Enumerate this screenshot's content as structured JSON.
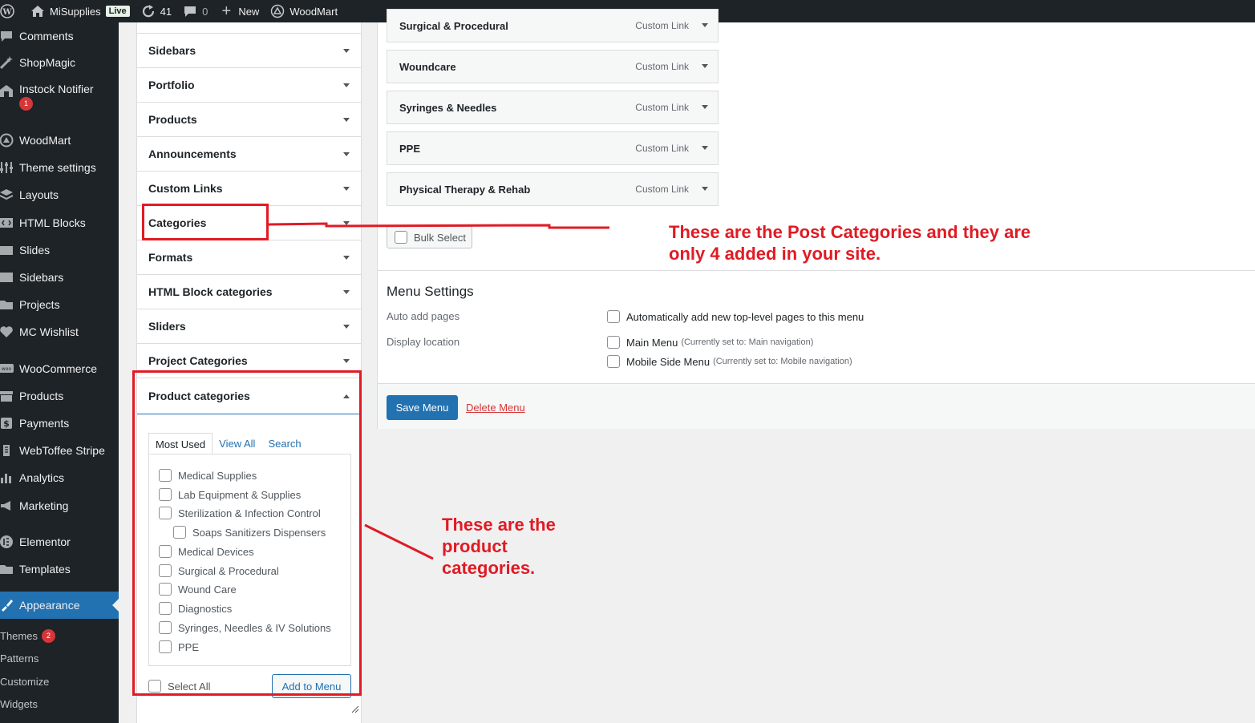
{
  "adminbar": {
    "site_name": "MiSupplies",
    "live_label": "Live",
    "updates_count": "41",
    "comments_count": "0",
    "new_label": "New",
    "theme_label": "WoodMart"
  },
  "sidebar": {
    "items": [
      {
        "label": "Comments",
        "icon": "comments-icon"
      },
      {
        "label": "ShopMagic",
        "icon": "wand-icon"
      },
      {
        "label": "Instock Notifier",
        "icon": "store-icon",
        "badge": "1"
      },
      {
        "label": "WoodMart",
        "icon": "woodmart-icon"
      },
      {
        "label": "Theme settings",
        "icon": "sliders-icon"
      },
      {
        "label": "Layouts",
        "icon": "layers-icon"
      },
      {
        "label": "HTML Blocks",
        "icon": "code-icon"
      },
      {
        "label": "Slides",
        "icon": "slides-icon"
      },
      {
        "label": "Sidebars",
        "icon": "sidebars-icon"
      },
      {
        "label": "Projects",
        "icon": "folder-icon"
      },
      {
        "label": "MC Wishlist",
        "icon": "heart-icon"
      },
      {
        "label": "WooCommerce",
        "icon": "woo-icon"
      },
      {
        "label": "Products",
        "icon": "archive-icon"
      },
      {
        "label": "Payments",
        "icon": "dollar-icon"
      },
      {
        "label": "WebToffee Stripe",
        "icon": "stripe-icon"
      },
      {
        "label": "Analytics",
        "icon": "bar-chart-icon"
      },
      {
        "label": "Marketing",
        "icon": "megaphone-icon"
      },
      {
        "label": "Elementor",
        "icon": "elementor-icon"
      },
      {
        "label": "Templates",
        "icon": "templates-icon"
      },
      {
        "label": "Appearance",
        "icon": "brush-icon"
      }
    ],
    "submenu": [
      {
        "label": "Themes",
        "badge": "2"
      },
      {
        "label": "Patterns"
      },
      {
        "label": "Customize"
      },
      {
        "label": "Widgets"
      }
    ]
  },
  "accordion": {
    "sections": [
      "Sidebars",
      "Portfolio",
      "Products",
      "Announcements",
      "Custom Links",
      "Categories",
      "Formats",
      "HTML Block categories",
      "Sliders",
      "Project Categories"
    ],
    "open_section": "Product categories",
    "tabs": [
      "Most Used",
      "View All",
      "Search"
    ],
    "categories": [
      {
        "label": "Medical Supplies"
      },
      {
        "label": "Lab Equipment & Supplies"
      },
      {
        "label": "Sterilization & Infection Control"
      },
      {
        "label": "Soaps Sanitizers Dispensers"
      },
      {
        "label": "Medical Devices"
      },
      {
        "label": "Surgical & Procedural"
      },
      {
        "label": "Wound Care"
      },
      {
        "label": "Diagnostics"
      },
      {
        "label": "Syringes, Needles & IV Solutions"
      },
      {
        "label": "PPE"
      }
    ],
    "select_all_label": "Select All",
    "add_to_menu_label": "Add to Menu"
  },
  "menu_items": [
    {
      "label": "Surgical & Procedural",
      "type": "Custom Link"
    },
    {
      "label": "Woundcare",
      "type": "Custom Link"
    },
    {
      "label": "Syringes & Needles",
      "type": "Custom Link"
    },
    {
      "label": "PPE",
      "type": "Custom Link"
    },
    {
      "label": "Physical Therapy & Rehab",
      "type": "Custom Link"
    }
  ],
  "bulk_select_label": "Bulk Select",
  "menu_settings": {
    "heading": "Menu Settings",
    "auto_add_label": "Auto add pages",
    "auto_add_option": "Automatically add new top-level pages to this menu",
    "display_location_label": "Display location",
    "locations": [
      {
        "label": "Main Menu",
        "note": "(Currently set to: Main navigation)"
      },
      {
        "label": "Mobile Side Menu",
        "note": "(Currently set to: Mobile navigation)"
      }
    ]
  },
  "actions": {
    "save_label": "Save Menu",
    "delete_label": "Delete Menu"
  },
  "annotations": {
    "post_categories_note": "These are the Post Categories and they are only 4 added in your site.",
    "product_categories_note": "These are the product categories.",
    "color": "#e01b24"
  }
}
